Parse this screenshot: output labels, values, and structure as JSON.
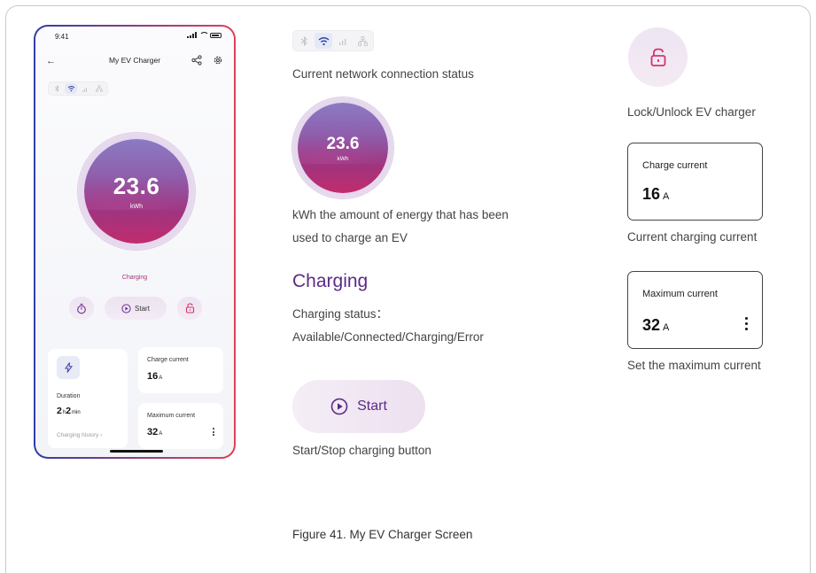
{
  "phone": {
    "status_time": "9:41",
    "app_title": "My EV Charger",
    "energy_value": "23.6",
    "energy_unit": "kWh",
    "charging_status": "Charging",
    "start_label": "Start",
    "duration_label": "Duration",
    "duration_hours": "2",
    "duration_hours_unit": "h",
    "duration_minutes": "2",
    "duration_minutes_unit": "min",
    "history_link": "Charging history",
    "charge_current_label": "Charge current",
    "charge_current_value": "16",
    "charge_current_unit": "A",
    "max_current_label": "Maximum current",
    "max_current_value": "32",
    "max_current_unit": "A"
  },
  "annotations": {
    "network_caption": "Current network connection status",
    "energy_value": "23.6",
    "energy_unit": "kWh",
    "energy_caption_line1": "kWh the amount of energy that has been",
    "energy_caption_line2": "used to charge an EV",
    "status_title": "Charging",
    "status_caption_line1": "Charging status：",
    "status_caption_line2": "Available/Connected/Charging/Error",
    "start_label": "Start",
    "start_caption": "Start/Stop charging button",
    "lock_caption": "Lock/Unlock EV charger",
    "charge_box_label": "Charge current",
    "charge_box_value": "16",
    "charge_box_unit": "A",
    "charge_box_caption": "Current charging current",
    "max_box_label": "Maximum current",
    "max_box_value": "32",
    "max_box_unit": "A",
    "max_box_caption": "Set the maximum current"
  },
  "figure_caption": "Figure 41. My EV Charger Screen",
  "colors": {
    "accent_purple": "#5b2b86",
    "accent_magenta": "#a0327a",
    "border_gradient_start": "#2f3fa5",
    "border_gradient_end": "#e0405a",
    "gauge_top": "#8c7bc4",
    "gauge_bottom": "#c12c6d"
  },
  "icons": [
    "back-arrow-icon",
    "share-icon",
    "gear-icon",
    "bluetooth-icon",
    "wifi-icon",
    "cellular-icon",
    "ethernet-icon",
    "timer-icon",
    "play-icon",
    "unlock-icon",
    "lightning-icon",
    "chevron-right-icon",
    "more-vert-icon"
  ]
}
